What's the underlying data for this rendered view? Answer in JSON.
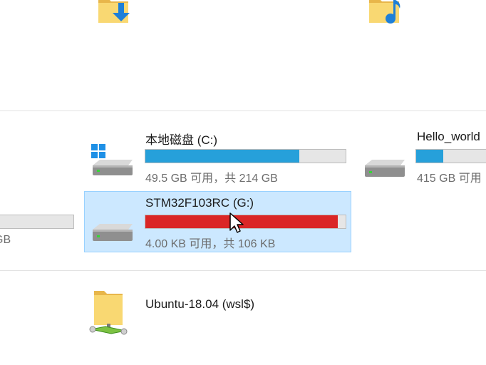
{
  "window": {
    "background": "#ffffff"
  },
  "folders": [
    {
      "icon": "downloads-folder-icon"
    },
    {
      "icon": "music-folder-icon"
    }
  ],
  "drives": [
    {
      "name": "本地磁盘 (C:)",
      "free_text": "49.5 GB 可用，共 214 GB",
      "used_fraction": 0.77,
      "fill_color": "#26a0da",
      "icon": "windows-drive-icon"
    },
    {
      "name": "Hello_world",
      "free_text": "415 GB 可用",
      "used_fraction": 0.32,
      "fill_color": "#26a0da",
      "icon": "hard-drive-icon"
    },
    {
      "name": "",
      "free_text": "GB",
      "used_fraction": 0.0,
      "fill_color": "#26a0da",
      "icon": "hard-drive-icon"
    },
    {
      "name": "STM32F103RC (G:)",
      "free_text": "4.00 KB 可用，共 106 KB",
      "used_fraction": 0.96,
      "fill_color": "#da2626",
      "icon": "hard-drive-icon",
      "selected": true
    }
  ],
  "network_locations": [
    {
      "name": "Ubuntu-18.04 (wsl$)",
      "icon": "network-folder-icon"
    }
  ]
}
